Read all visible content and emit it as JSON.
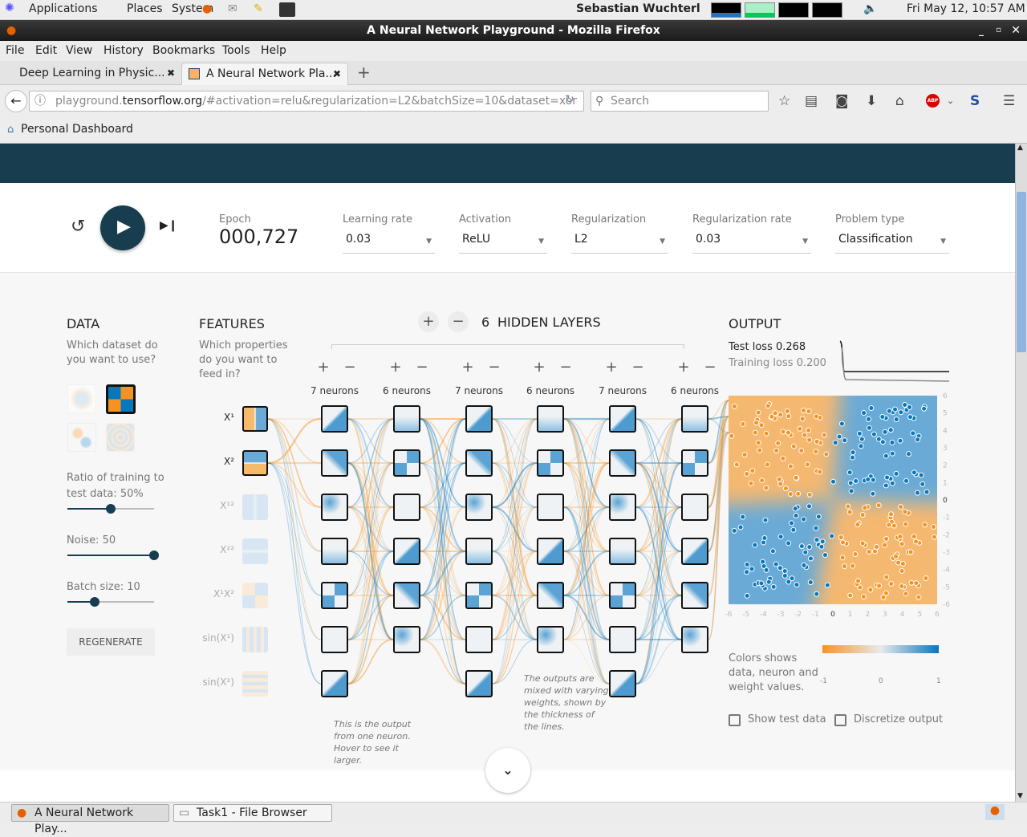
{
  "desktop": {
    "menus": [
      "Applications",
      "Places",
      "System"
    ],
    "user": "Sebastian Wuchterl",
    "clock": "Fri May 12, 10:57 AM"
  },
  "window": {
    "title": "A Neural Network Playground - Mozilla Firefox"
  },
  "menubar": [
    "File",
    "Edit",
    "View",
    "History",
    "Bookmarks",
    "Tools",
    "Help"
  ],
  "tabs": [
    {
      "label": "Deep Learning in Physic...",
      "active": false
    },
    {
      "label": "A Neural Network Pla...",
      "active": true
    }
  ],
  "nav": {
    "url_host_pre": "playground.",
    "url_host": "tensorflow.org",
    "url_rest": "/#activation=relu&regularization=L2&batchSize=10&dataset=xor",
    "search_placeholder": "Search"
  },
  "bookmarks": [
    "Personal Dashboard"
  ],
  "controls": {
    "epoch_label": "Epoch",
    "epoch": "000,727",
    "learning_rate": {
      "label": "Learning rate",
      "value": "0.03"
    },
    "activation": {
      "label": "Activation",
      "value": "ReLU"
    },
    "regularization": {
      "label": "Regularization",
      "value": "L2"
    },
    "regularization_rate": {
      "label": "Regularization rate",
      "value": "0.03"
    },
    "problem_type": {
      "label": "Problem type",
      "value": "Classification"
    }
  },
  "data_panel": {
    "title": "DATA",
    "question": [
      "Which dataset do",
      "you want to use?"
    ],
    "ratio_label": [
      "Ratio of training to",
      "test data:  50%"
    ],
    "ratio": 50,
    "noise_label": "Noise:  50",
    "noise": 50,
    "batch_label": "Batch size:  10",
    "batch": 10,
    "regenerate": "REGENERATE",
    "selected_dataset": "xor"
  },
  "features": {
    "title": "FEATURES",
    "question": [
      "Which properties",
      "do you want to",
      "feed in?"
    ],
    "items": [
      {
        "label": "X¹",
        "active": true
      },
      {
        "label": "X²",
        "active": true
      },
      {
        "label": "X¹²",
        "active": false
      },
      {
        "label": "X²²",
        "active": false
      },
      {
        "label": "X¹X²",
        "active": false
      },
      {
        "label": "sin(X¹)",
        "active": false
      },
      {
        "label": "sin(X²)",
        "active": false
      }
    ]
  },
  "network": {
    "count": "6",
    "hidden_layers_label": "HIDDEN LAYERS",
    "layers": [
      {
        "label": "7 neurons",
        "n": 7
      },
      {
        "label": "6 neurons",
        "n": 6
      },
      {
        "label": "7 neurons",
        "n": 7
      },
      {
        "label": "6 neurons",
        "n": 6
      },
      {
        "label": "7 neurons",
        "n": 7
      },
      {
        "label": "6 neurons",
        "n": 6
      }
    ],
    "note1": [
      "This is the output",
      "from one neuron.",
      "Hover to see it",
      "larger."
    ],
    "note2": [
      "The outputs are",
      "mixed with varying",
      "weights, shown by",
      "the thickness of",
      "the lines."
    ]
  },
  "output": {
    "title": "OUTPUT",
    "test_loss_label": "Test loss",
    "test_loss": "0.268",
    "train_loss_label": "Training loss",
    "train_loss": "0.200",
    "axis_ticks": [
      "-6",
      "-5",
      "-4",
      "-3",
      "-2",
      "-1",
      "0",
      "1",
      "2",
      "3",
      "4",
      "5",
      "6"
    ],
    "legend_text": [
      "Colors shows",
      "data, neuron and",
      "weight values."
    ],
    "legend_ticks": [
      "-1",
      "0",
      "1"
    ],
    "show_test": "Show test data",
    "discretize": "Discretize output"
  },
  "colors": {
    "orange": "#f59322",
    "blue": "#0877bd",
    "header": "#183d4e"
  },
  "taskbar": [
    "A Neural Network Play...",
    "Task1 - File Browser"
  ]
}
